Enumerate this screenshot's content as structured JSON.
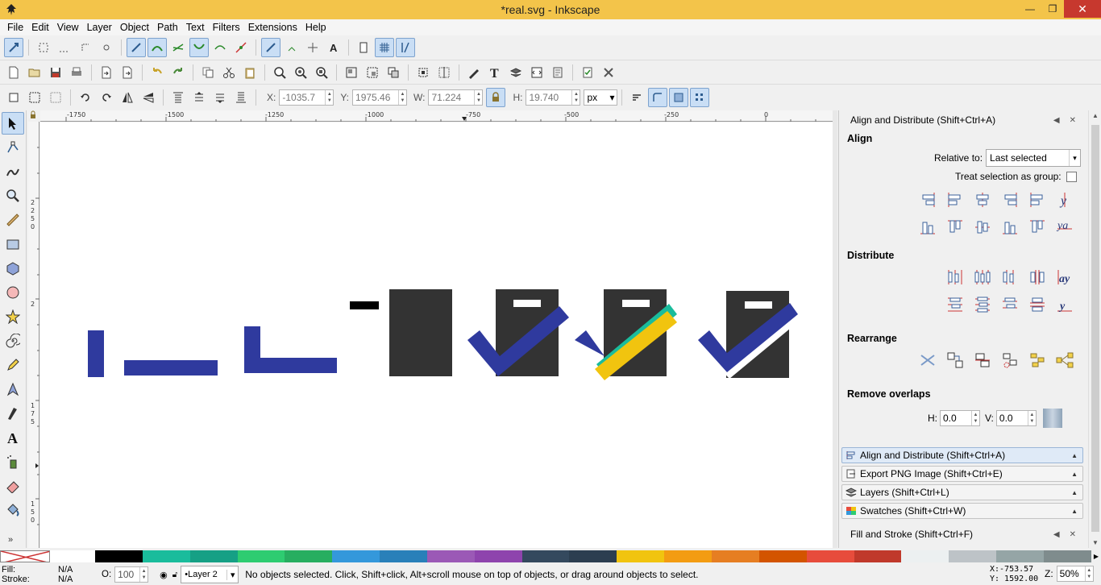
{
  "window": {
    "title": "*real.svg - Inkscape",
    "minimize": "—",
    "maximize": "❐",
    "close": "✕"
  },
  "menu": {
    "file": "File",
    "edit": "Edit",
    "view": "View",
    "layer": "Layer",
    "object": "Object",
    "path": "Path",
    "text": "Text",
    "filters": "Filters",
    "extensions": "Extensions",
    "help": "Help"
  },
  "tool_controls": {
    "x_label": "X:",
    "x_value": "-1035.7",
    "y_label": "Y:",
    "y_value": "1975.46",
    "w_label": "W:",
    "w_value": "71.224",
    "h_label": "H:",
    "h_value": "19.740",
    "unit": "px"
  },
  "rulers": {
    "h_ticks": [
      "-1750",
      "-1500",
      "-1250",
      "-1000",
      "-750",
      "-500",
      "-250",
      "0"
    ],
    "v_ticks": [
      "2",
      "2",
      "5",
      "0",
      "2",
      "1",
      "7",
      "5",
      "1",
      "5",
      "0"
    ]
  },
  "colors": {
    "blue": "#2f3a9e",
    "dark": "#333333",
    "teal": "#1abc9c",
    "yellow": "#f1c40f"
  },
  "dock": {
    "align_title": "Align and Distribute (Shift+Ctrl+A)",
    "align_section": "Align",
    "relative_to_label": "Relative to:",
    "relative_to_value": "Last selected",
    "treat_group_label": "Treat selection as group:",
    "distribute_section": "Distribute",
    "rearrange_section": "Rearrange",
    "remove_overlaps_section": "Remove overlaps",
    "h_label": "H:",
    "h_value": "0.0",
    "v_label": "V:",
    "v_value": "0.0",
    "collapsed": [
      {
        "label": "Align and Distribute (Shift+Ctrl+A)"
      },
      {
        "label": "Export PNG Image (Shift+Ctrl+E)"
      },
      {
        "label": "Layers (Shift+Ctrl+L)"
      },
      {
        "label": "Swatches (Shift+Ctrl+W)"
      }
    ],
    "fill_stroke_title": "Fill and Stroke (Shift+Ctrl+F)"
  },
  "palette": [
    "#000000",
    "#1abc9c",
    "#16a085",
    "#2ecc71",
    "#27ae60",
    "#3498db",
    "#2980b9",
    "#9b59b6",
    "#8e44ad",
    "#34495e",
    "#2c3e50",
    "#f1c40f",
    "#f39c12",
    "#e67e22",
    "#d35400",
    "#e74c3c",
    "#c0392b",
    "#ecf0f1",
    "#bdc3c7",
    "#95a5a6",
    "#7f8c8d"
  ],
  "status": {
    "fill_label": "Fill:",
    "fill_value": "N/A",
    "stroke_label": "Stroke:",
    "stroke_value": "N/A",
    "opacity_label": "O:",
    "opacity_value": "100",
    "layer": "•Layer 2",
    "message": "No objects selected. Click, Shift+click, Alt+scroll mouse on top of objects, or drag around objects to select.",
    "x_coord": "X:-753.57",
    "y_coord": "Y: 1592.00",
    "zoom_label": "Z:",
    "zoom_value": "50%"
  }
}
